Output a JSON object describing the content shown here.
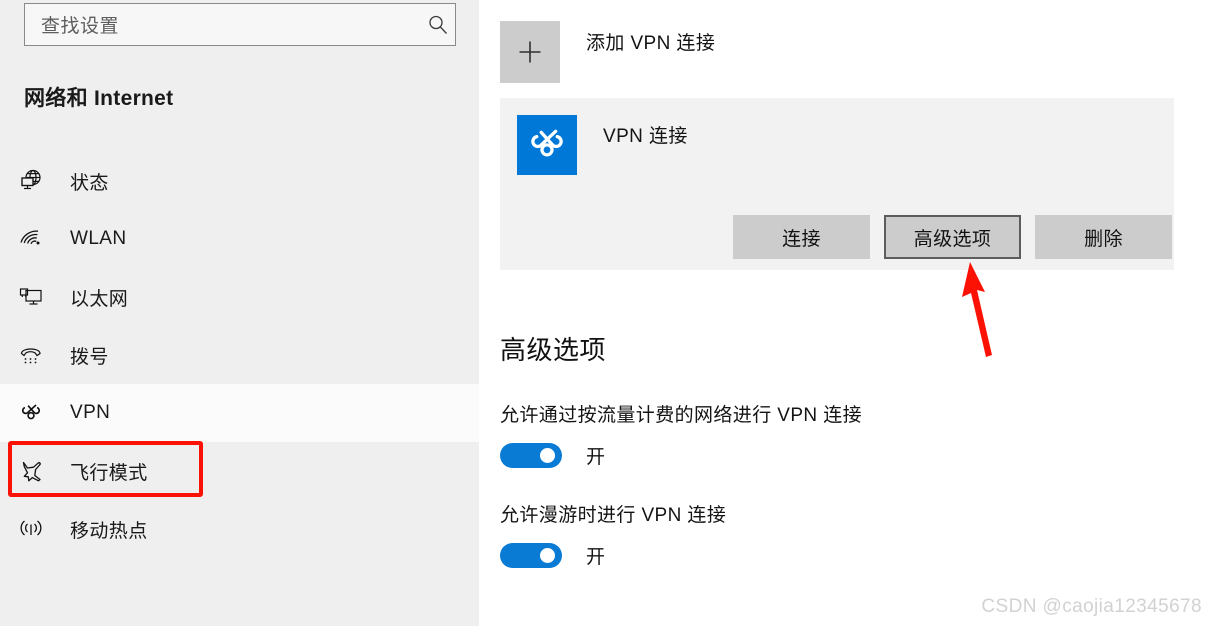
{
  "search": {
    "placeholder": "查找设置",
    "icon": "search-icon"
  },
  "sidebar": {
    "title": "网络和 Internet",
    "items": [
      {
        "label": "状态",
        "icon": "globe-status-icon",
        "selected": false
      },
      {
        "label": "WLAN",
        "icon": "wifi-icon",
        "selected": false
      },
      {
        "label": "以太网",
        "icon": "ethernet-monitor-icon",
        "selected": false
      },
      {
        "label": "拨号",
        "icon": "dialup-phone-icon",
        "selected": false
      },
      {
        "label": "VPN",
        "icon": "vpn-knot-icon",
        "selected": true
      },
      {
        "label": "飞行模式",
        "icon": "airplane-icon",
        "selected": false
      },
      {
        "label": "移动热点",
        "icon": "hotspot-antenna-icon",
        "selected": false
      }
    ]
  },
  "main": {
    "add_vpn": {
      "label": "添加 VPN 连接",
      "icon": "plus-icon"
    },
    "connection": {
      "name": "VPN 连接",
      "icon": "vpn-knot-icon",
      "buttons": [
        {
          "label": "连接",
          "focused": false
        },
        {
          "label": "高级选项",
          "focused": true
        },
        {
          "label": "删除",
          "focused": false
        }
      ]
    },
    "advanced": {
      "heading": "高级选项",
      "settings": [
        {
          "label": "允许通过按流量计费的网络进行 VPN 连接",
          "state": "开",
          "on": true
        },
        {
          "label": "允许漫游时进行 VPN 连接",
          "state": "开",
          "on": true
        }
      ]
    }
  },
  "annotations": {
    "highlight_target": "VPN",
    "arrow_target": "高级选项",
    "color": "#fc1105"
  },
  "watermark": "CSDN @caojia12345678",
  "colors": {
    "accent": "#0078d7",
    "toggle_on": "#0a7bd4",
    "sidebar_bg": "#efefef",
    "card_bg": "#f2f2f2",
    "button_bg": "#cccccc",
    "annotation_red": "#fc1105"
  }
}
